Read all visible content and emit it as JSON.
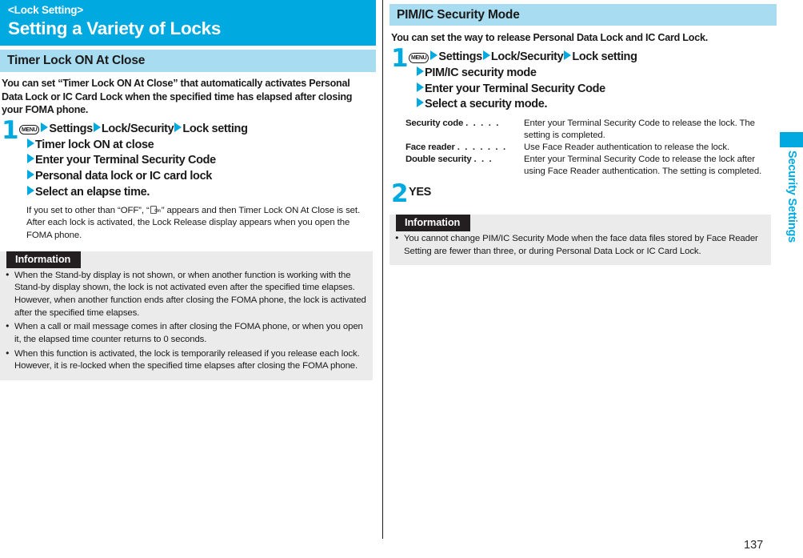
{
  "page": {
    "number": "137",
    "thumb_tab": "Security Settings",
    "accent_color": "#00a9e0",
    "section_bar_color": "#a8dcf0",
    "info_header_color": "#231f20",
    "info_body_color": "#ebebeb"
  },
  "chapter": {
    "kicker": "<Lock Setting>",
    "title": "Setting a Variety of Locks"
  },
  "left": {
    "section_title": "Timer Lock ON At Close",
    "lead": "You can set “Timer Lock ON At Close” that automatically activates Personal Data Lock or IC Card Lock when the specified time has elapsed after closing your FOMA phone.",
    "step": {
      "number": "1",
      "menu_key": "MENU",
      "line1_parts": [
        "Settings",
        "Lock/Security",
        "Lock setting"
      ],
      "line2": "Timer lock ON at close",
      "line3": "Enter your Terminal Security Code",
      "line4": "Personal data lock or IC card lock",
      "line5": "Select an elapse time."
    },
    "note_before": "If you set to other than “OFF”, “",
    "note_icon": "timer-lock-icon",
    "note_icon_sub": "On",
    "note_after": "” appears and then Timer Lock ON At Close is set. After each lock is activated, the Lock Release display appears when you open the FOMA phone.",
    "info": {
      "header": "Information",
      "items": [
        "When the Stand-by display is not shown, or when another function is working with the Stand-by display shown, the lock is not activated even after the specified time elapses. However, when another function ends after closing the FOMA phone, the lock is activated after the specified time elapses.",
        "When a call or mail message comes in after closing the FOMA phone, or when you open it, the elapsed time counter returns to 0 seconds.",
        "When this function is activated, the lock is temporarily released if you release each lock. However, it is re-locked when the specified time elapses after closing the FOMA phone."
      ]
    }
  },
  "right": {
    "section_title": "PIM/IC Security Mode",
    "lead": "You can set the way to release Personal Data Lock and IC Card Lock.",
    "step1": {
      "number": "1",
      "menu_key": "MENU",
      "line1_parts": [
        "Settings",
        "Lock/Security",
        "Lock setting"
      ],
      "line2": "PIM/IC security mode",
      "line3": "Enter your Terminal Security Code",
      "line4": "Select a security mode."
    },
    "modes": [
      {
        "term": "Security code",
        "dots": ". . . . .",
        "desc": "Enter your Terminal Security Code to release the lock. The setting is completed."
      },
      {
        "term": "Face reader",
        "dots": ". . . . . . .",
        "desc": "Use Face Reader authentication to release the lock."
      },
      {
        "term": "Double security",
        "dots": ". . .",
        "desc": "Enter your Terminal Security Code to release the lock after using Face Reader authentication. The setting is completed."
      }
    ],
    "step2": {
      "number": "2",
      "label": "YES"
    },
    "info": {
      "header": "Information",
      "items": [
        "You cannot change PIM/IC Security Mode when the face data files stored by Face Reader Setting are fewer than three, or during Personal Data Lock or IC Card Lock."
      ]
    }
  }
}
